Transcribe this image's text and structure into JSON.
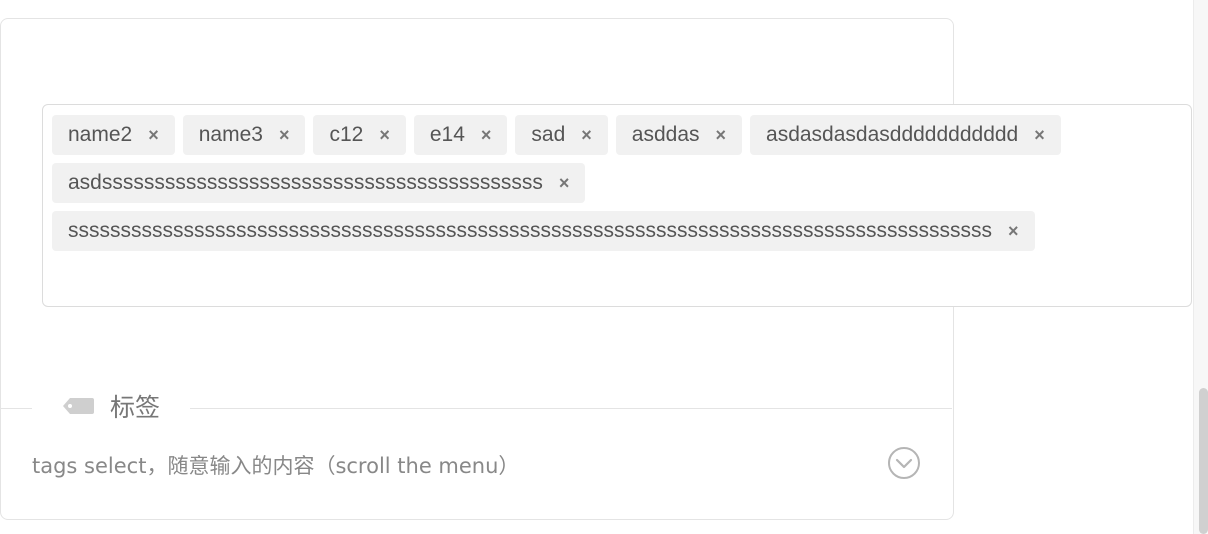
{
  "tags": [
    {
      "label": "name2"
    },
    {
      "label": "name3"
    },
    {
      "label": "c12"
    },
    {
      "label": "e14"
    },
    {
      "label": "sad"
    },
    {
      "label": "asddas"
    },
    {
      "label": "asdasdasdasddddddddddd"
    },
    {
      "label": "asdssssssssssssssssssssssssssssssssssssssssss"
    },
    {
      "label": "ssssssssssssssssssssssssssssssssssssssssssssssssssssssssssssssssssssssssssssssssssssssss"
    }
  ],
  "remove_glyph": "×",
  "section": {
    "title": "标签",
    "icon": "tag-icon"
  },
  "select": {
    "placeholder": "tags select，随意输入的内容（scroll the menu）",
    "toggle_icon": "chevron-down-circle-icon"
  },
  "colors": {
    "tag_bg": "#f1f1f1",
    "border": "#e4e4e4",
    "text": "#555555"
  }
}
